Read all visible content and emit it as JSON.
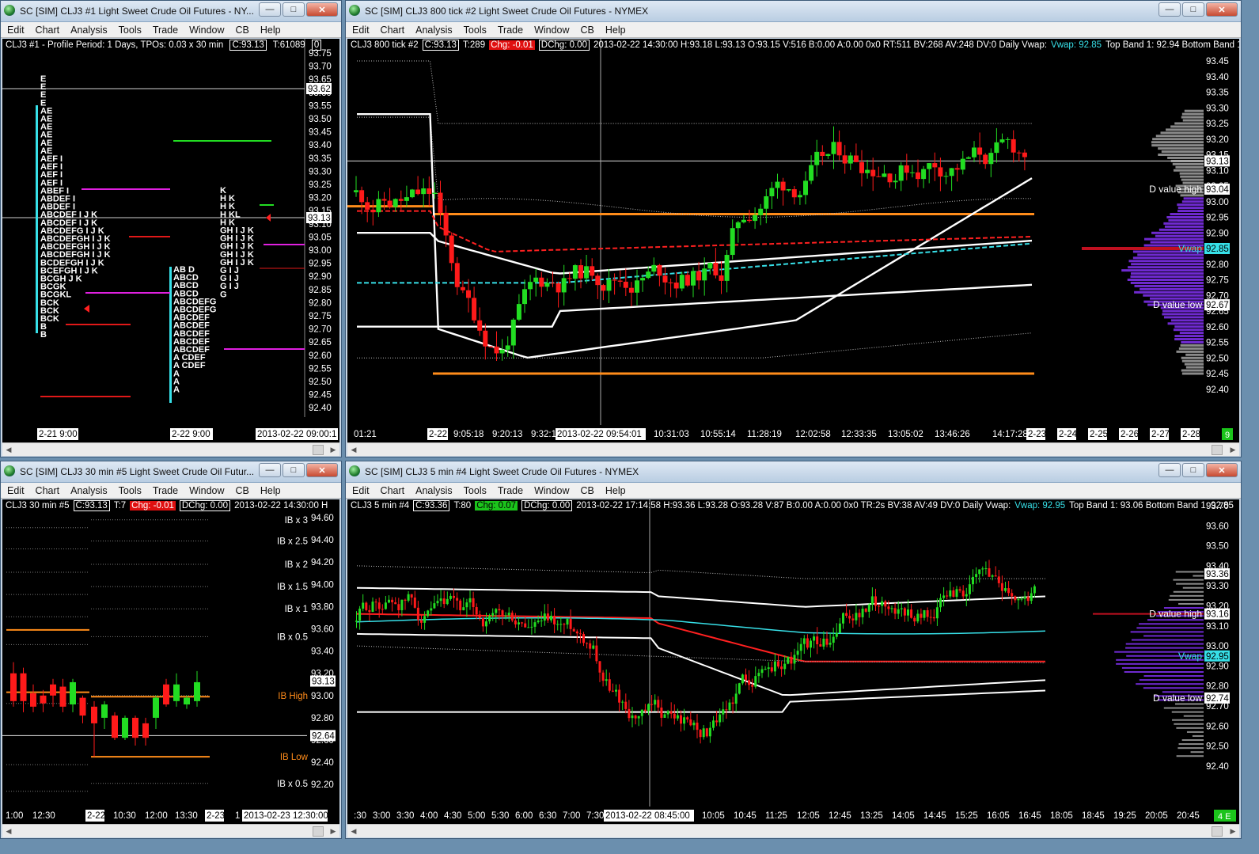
{
  "colors": {
    "up": "#22dd22",
    "down": "#ff1a1a",
    "vwap": "#37e0e8",
    "orange": "#ff8c1a",
    "purple": "#7a2ad8",
    "magenta": "#e020e0"
  },
  "menu": [
    "Edit",
    "Chart",
    "Analysis",
    "Tools",
    "Trade",
    "Window",
    "CB",
    "Help"
  ],
  "win1": {
    "title": "SC [SIM] CLJ3  #1  Light Sweet Crude Oil Futures - NY...",
    "header": {
      "a": "CLJ3  #1 - Profile Period: 1 Days, TPOs: 0.03 x 30 min",
      "c": "C:93.13",
      "t": "T:61089",
      "x": "0"
    },
    "yaxis": [
      "93.75",
      "93.70",
      "93.65",
      "93.60",
      "93.55",
      "93.50",
      "93.45",
      "93.40",
      "93.35",
      "93.30",
      "93.25",
      "93.20",
      "93.15",
      "93.10",
      "93.05",
      "93.00",
      "92.95",
      "92.90",
      "92.85",
      "92.80",
      "92.75",
      "92.70",
      "92.65",
      "92.60",
      "92.55",
      "92.50",
      "92.45",
      "92.40"
    ],
    "price_box_a": "93.62",
    "price_box_b": "93.13",
    "xaxis": [
      "2-21  9:00",
      "2-22  9:00",
      "2013-02-22  09:00:1"
    ],
    "profile1": [
      "E",
      "E",
      "E",
      "E",
      "AE",
      "AE",
      "AE",
      "AE",
      "AE",
      "AE",
      "AEF I",
      "AEF I",
      "AEF I",
      "AEF I",
      "ABEF I",
      "ABDEF I",
      "ABDEF I",
      "ABCDEF I J K",
      "ABCDEF I J K",
      "ABCDEFG I J K",
      "ABCDEFGH I J K",
      "ABCDEFGH I J K",
      "ABCDEFGH I J K",
      "BCDEFGH I J K",
      "BCEFGH I J K",
      "BCGH J K",
      "BCGK",
      "BCGKL",
      "BCK",
      "BCK",
      "BCK",
      "B",
      "B"
    ],
    "profile2": [
      "AB D",
      "ABCD",
      "ABCD",
      "ABCD",
      "ABCDEFG",
      "ABCDEFG",
      "ABCDEF",
      "ABCDEF",
      "ABCDEF",
      "ABCDEF",
      "ABCDEF",
      "A  CDEF",
      "A  CDEF",
      "A",
      "A",
      "A"
    ],
    "profile3": [
      "K",
      "H  K",
      "H  K",
      "H  KL",
      "H  K",
      "GH I J K",
      "GH I J K",
      "GH I J K",
      "GH I J K",
      "GH I J K",
      "G  I  J",
      "G  I  J",
      "G  I  J",
      "G"
    ]
  },
  "win2": {
    "title": "SC [SIM] CLJ3  800 tick  #2  Light Sweet Crude Oil Futures - NYMEX",
    "header": {
      "name": "CLJ3  800 tick  #2",
      "c": "C:93.13",
      "t": "T:289",
      "chg": "Chg: -0.01",
      "dchg": "DChg: 0.00",
      "info": "2013-02-22 14:30:00 H:93.18 L:93.13 O:93.15 V:516 B:0.00 A:0.00 0x0 RT:511 BV:268 AV:248 DV:0  Daily Vwap:",
      "vwap": "Vwap: 92.85",
      "bands": "Top Band 1: 92.94  Bottom Band 1"
    },
    "yaxis": [
      "93.45",
      "93.40",
      "93.35",
      "93.30",
      "93.25",
      "93.20",
      "93.15",
      "93.10",
      "93.05",
      "93.00",
      "92.95",
      "92.90",
      "92.85",
      "92.80",
      "92.75",
      "92.70",
      "92.65",
      "92.60",
      "92.55",
      "92.50",
      "92.45",
      "92.40"
    ],
    "price_box": "93.13",
    "dvh_box": "93.04",
    "vwap_box": "92.85",
    "dvl_box": "92.67",
    "labels": {
      "dvh": "D value high",
      "vwap": "Vwap",
      "dvl": "D value low"
    },
    "xaxis": [
      "01:21",
      "2-22",
      "9:05:18",
      "9:20:13",
      "9:32:1",
      "2013-02-22  09:54:01",
      "10:31:03",
      "10:55:14",
      "11:28:19",
      "12:02:58",
      "12:33:35",
      "13:05:02",
      "13:46:26",
      "14:17:28",
      "2-23",
      "2-24",
      "2-25",
      "2-26",
      "2-27",
      "2-28"
    ],
    "corner": "9"
  },
  "win3": {
    "title": "SC [SIM] CLJ3  30 min  #5  Light Sweet Crude Oil Futur...",
    "header": {
      "name": "CLJ3  30 min  #5",
      "c": "C:93.13",
      "t": "T:7",
      "chg": "Chg: -0.01",
      "dchg": "DChg: 0.00",
      "info": "2013-02-22 14:30:00  H"
    },
    "yaxis": [
      "94.60",
      "94.40",
      "94.20",
      "94.00",
      "93.80",
      "93.60",
      "93.40",
      "93.20",
      "93.00",
      "92.80",
      "92.60",
      "92.40",
      "92.20"
    ],
    "ib_labels": [
      "IB x 3",
      "IB x 2.5",
      "IB x 2",
      "IB x 1.5",
      "IB x 1",
      "IB x 0.5",
      "IB High",
      "IB Low",
      "IB x 0.5"
    ],
    "price_box_a": "93.13",
    "price_box_b": "92.64",
    "xaxis": [
      "1:00",
      "12:30",
      "2-22",
      "10:30",
      "12:00",
      "13:30",
      "2-23",
      "1",
      "2013-02-23  12:30:00"
    ]
  },
  "win4": {
    "title": "SC [SIM] CLJ3  5 min  #4  Light Sweet Crude Oil Futures - NYMEX",
    "header": {
      "name": "CLJ3  5 min   #4",
      "c": "C:93.36",
      "t": "T:80",
      "chg": "Chg: 0.07",
      "dchg": "DChg: 0.00",
      "info": "2013-02-22 17:14:58 H:93.36 L:93.28 O:93.28 V:87 B:0.00 A:0.00 0x0 TR:2s BV:38 AV:49 DV:0  Daily Vwap:",
      "vwap": "Vwap: 92.95",
      "bands": "Top Band 1: 93.06  Bottom Band 1: 92.85"
    },
    "yaxis": [
      "93.70",
      "93.60",
      "93.50",
      "93.40",
      "93.30",
      "93.20",
      "93.10",
      "93.00",
      "92.90",
      "92.80",
      "92.70",
      "92.60",
      "92.50",
      "92.40"
    ],
    "price_box": "93.36",
    "dvh_box": "93.16",
    "vwap_box": "92.95",
    "dvl_box": "92.74",
    "labels": {
      "dvh": "D value high",
      "vwap": "Vwap",
      "dvl": "D value low"
    },
    "xaxis": [
      ":30",
      "3:00",
      "3:30",
      "4:00",
      "4:30",
      "5:00",
      "5:30",
      "6:00",
      "6:30",
      "7:00",
      "7:30",
      "2013-02-22  08:45:00",
      "10:05",
      "10:45",
      "11:25",
      "12:05",
      "12:45",
      "13:25",
      "14:05",
      "14:45",
      "15:25",
      "16:05",
      "16:45",
      "18:05",
      "18:45",
      "19:25",
      "20:05",
      "20:45"
    ],
    "corner": "4 E"
  }
}
